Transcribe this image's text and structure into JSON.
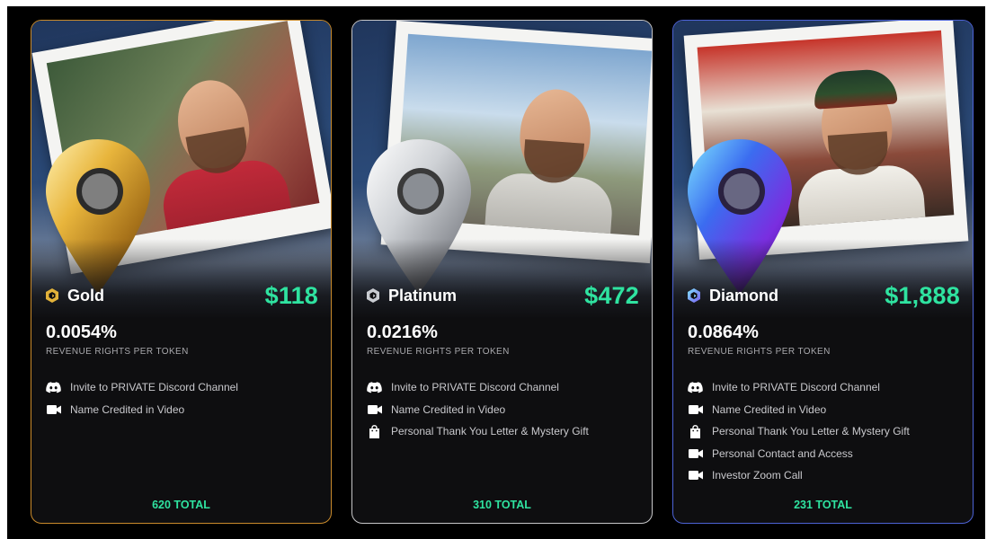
{
  "cards": [
    {
      "tier": "Gold",
      "price": "$118",
      "revenue_share": "0.0054%",
      "revenue_label": "REVENUE RIGHTS PER TOKEN",
      "perks": [
        {
          "icon": "discord-icon",
          "text": "Invite to PRIVATE Discord Channel"
        },
        {
          "icon": "video-camera-icon",
          "text": "Name Credited in Video"
        }
      ],
      "total": "620 TOTAL",
      "accent": "#c98a2b"
    },
    {
      "tier": "Platinum",
      "price": "$472",
      "revenue_share": "0.0216%",
      "revenue_label": "REVENUE RIGHTS PER TOKEN",
      "perks": [
        {
          "icon": "discord-icon",
          "text": "Invite to PRIVATE Discord Channel"
        },
        {
          "icon": "video-camera-icon",
          "text": "Name Credited in Video"
        },
        {
          "icon": "shopping-bag-icon",
          "text": "Personal Thank You Letter & Mystery Gift"
        }
      ],
      "total": "310 TOTAL",
      "accent": "#c7c7c9"
    },
    {
      "tier": "Diamond",
      "price": "$1,888",
      "revenue_share": "0.0864%",
      "revenue_label": "REVENUE RIGHTS PER TOKEN",
      "perks": [
        {
          "icon": "discord-icon",
          "text": "Invite to PRIVATE Discord Channel"
        },
        {
          "icon": "video-camera-icon",
          "text": "Name Credited in Video"
        },
        {
          "icon": "shopping-bag-icon",
          "text": "Personal Thank You Letter & Mystery Gift"
        },
        {
          "icon": "video-camera-icon",
          "text": "Personal Contact and Access"
        },
        {
          "icon": "video-camera-icon",
          "text": "Investor Zoom Call"
        }
      ],
      "total": "231 TOTAL",
      "accent": "#4d63d6"
    }
  ],
  "colors": {
    "price": "#2fe3a0",
    "background": "#000000",
    "card": "#0e0e10"
  }
}
